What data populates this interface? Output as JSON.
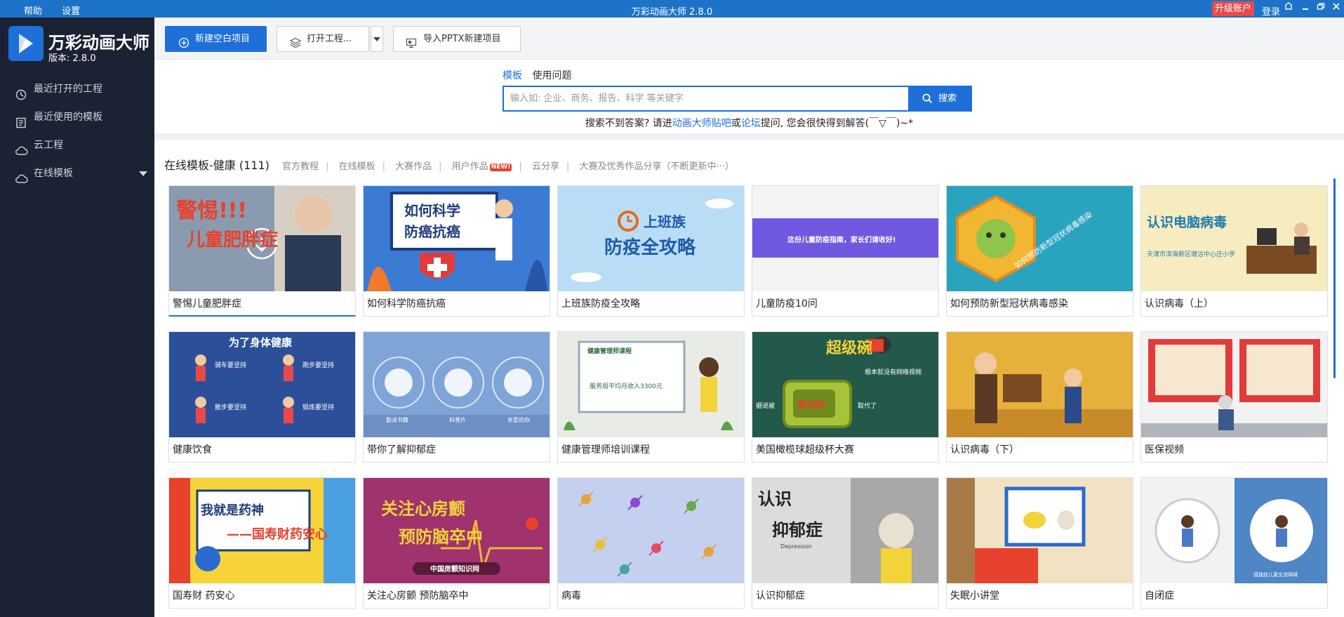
{
  "window": {
    "title": "万彩动画大师 2.8.0",
    "menu": [
      "帮助",
      "设置"
    ],
    "upgrade_label": "升级账户",
    "login_label": "登录"
  },
  "sidebar": {
    "app_name": "万彩动画大师",
    "version": "版本: 2.8.0",
    "items": [
      {
        "label": "最近打开的工程",
        "icon": "clock-icon"
      },
      {
        "label": "最近使用的模板",
        "icon": "template-icon"
      },
      {
        "label": "云工程",
        "icon": "cloud-icon"
      },
      {
        "label": "在线模板",
        "icon": "cloud-icon"
      }
    ]
  },
  "toolbar": {
    "new_label": "新建空白项目",
    "open_label": "打开工程...",
    "import_label": "导入PPTX新建项目"
  },
  "search": {
    "tabs": [
      "模板",
      "使用问题"
    ],
    "placeholder": "输入如: 企业、商务、报告、科学 等关键字",
    "button_label": "搜索",
    "help": {
      "prefix": "搜索不到答案? 请进",
      "link1": "动画大师贴吧",
      "or": "或",
      "link2": "论坛",
      "suffix": "提问, 您会很快得到解答(￣▽￣)~*"
    }
  },
  "section": {
    "title": "在线模板-健康 (111)",
    "nav": [
      "官方教程",
      "在线模板",
      "大赛作品",
      "用户作品",
      "云分享",
      "大赛及优秀作品分享（不断更新中···）"
    ],
    "new_badge": "NEW!"
  },
  "templates": [
    {
      "caption": "警惕儿童肥胖症",
      "thumb_text": [
        "警惕!!!",
        "儿童肥胖症"
      ],
      "bg": "#8a9bb0"
    },
    {
      "caption": "如何科学防癌抗癌",
      "thumb_text": [
        "如何科学",
        "防癌抗癌"
      ],
      "bg": "#3b7bd4"
    },
    {
      "caption": "上班族防疫全攻略",
      "thumb_text": [
        "上班族",
        "防疫全攻略"
      ],
      "bg": "#b9ddf5"
    },
    {
      "caption": "儿童防疫10问",
      "thumb_text": [
        "这份儿童防疫指南，家长们请收好!"
      ],
      "bg": "#f4f4f4"
    },
    {
      "caption": "如何预防新型冠状病毒感染",
      "thumb_text": [
        "如何预防新型冠状病毒感染"
      ],
      "bg": "#2aa3bf"
    },
    {
      "caption": "认识病毒（上）",
      "thumb_text": [
        "认识电脑病毒",
        "天津市滨海新区塘沽中心庄小学"
      ],
      "bg": "#f6ecc0"
    },
    {
      "caption": "健康饮食",
      "thumb_text": [
        "为了身体健康",
        "骑车要坚持",
        "跑步要坚持",
        "散步要坚持",
        "锻炼要坚持"
      ],
      "bg": "#2c4f9a"
    },
    {
      "caption": "带你了解抑郁症",
      "thumb_text": [
        "勤读书籍",
        "科普片",
        "亲爱的你"
      ],
      "bg": "#7fa4d8"
    },
    {
      "caption": "健康管理师培训课程",
      "thumb_text": [
        "健康管理师课程",
        "服务局平均月收入3300元"
      ],
      "bg": "#e9ece6"
    },
    {
      "caption": "美国橄榄球超级杯大赛",
      "thumb_text": [
        "超级碗",
        "根本就没有网络视频",
        "肥皂剧",
        "据说被",
        "取代了"
      ],
      "bg": "#23594a"
    },
    {
      "caption": "认识病毒（下）",
      "thumb_text": [],
      "bg": "#e6b13a"
    },
    {
      "caption": "医保视频",
      "thumb_text": [],
      "bg": "#f2f2f2"
    },
    {
      "caption": "国寿财 药安心",
      "thumb_text": [
        "我就是药神",
        "——国寿财药安心"
      ],
      "bg": "#f7d33a"
    },
    {
      "caption": "关注心房颤 预防脑卒中",
      "thumb_text": [
        "关注心房颤",
        "预防脑卒中",
        "中国房颤知识网"
      ],
      "bg": "#a0336d"
    },
    {
      "caption": "病毒",
      "thumb_text": [],
      "bg": "#c5d0f0"
    },
    {
      "caption": "认识抑郁症",
      "thumb_text": [
        "认识",
        "抑郁症",
        "Depression"
      ],
      "bg": "#dcdcdc"
    },
    {
      "caption": "失眠小讲堂",
      "thumb_text": [],
      "bg": "#f2e2c4"
    },
    {
      "caption": "自闭症",
      "thumb_text": [
        "孤独症儿童交流障碍"
      ],
      "bg": "#4f86c6"
    }
  ],
  "colors": {
    "accent": "#1e6fd8",
    "titlebar": "#1d73c7",
    "sidebar_bg": "#1a2233",
    "upgrade": "#e84b4b"
  }
}
